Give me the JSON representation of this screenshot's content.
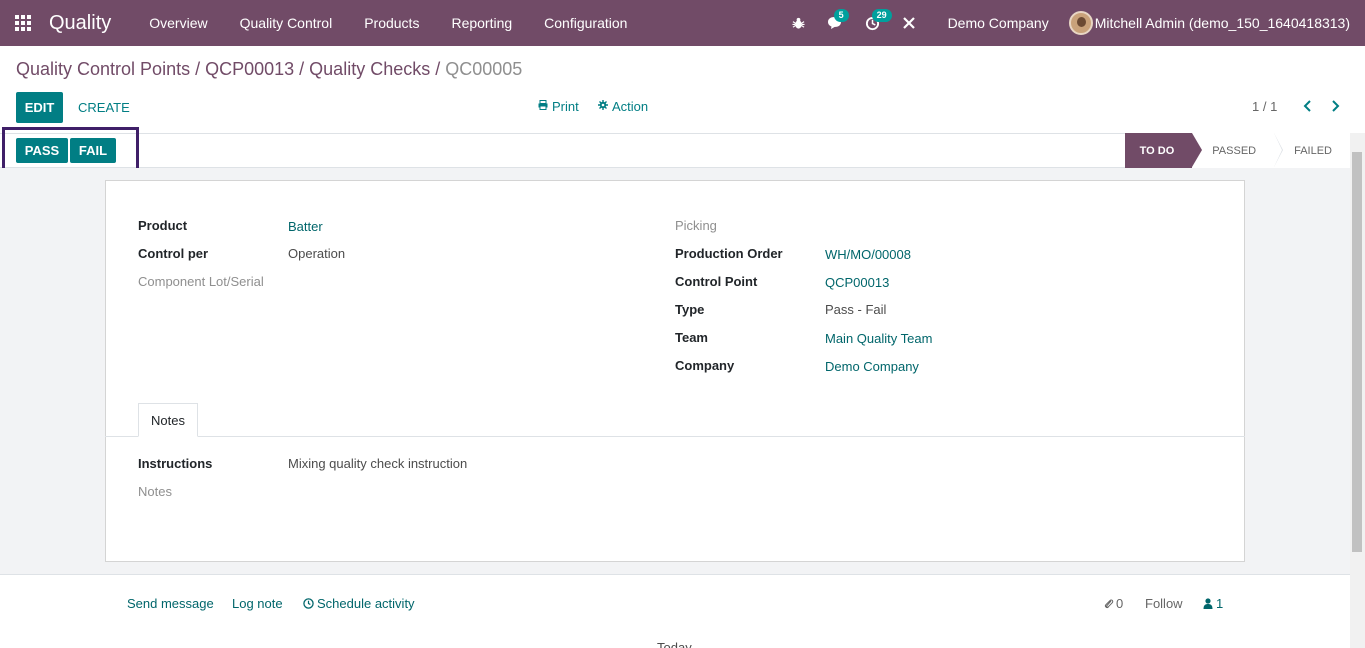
{
  "navbar": {
    "app_name": "Quality",
    "menu": [
      "Overview",
      "Quality Control",
      "Products",
      "Reporting",
      "Configuration"
    ],
    "messages_count": "5",
    "activities_count": "29",
    "company": "Demo Company",
    "user": "Mitchell Admin (demo_150_1640418313)"
  },
  "breadcrumb": {
    "items": [
      "Quality Control Points",
      "QCP00013",
      "Quality Checks"
    ],
    "separator": "/",
    "current": "QC00005"
  },
  "controls": {
    "edit": "EDIT",
    "create": "CREATE",
    "print": "Print",
    "action": "Action",
    "pager": "1 / 1"
  },
  "statusbar": {
    "pass": "PASS",
    "fail": "FAIL",
    "stages": [
      "TO DO",
      "PASSED",
      "FAILED"
    ],
    "current_stage": "TO DO"
  },
  "form": {
    "left": [
      {
        "label": "Product",
        "value": "Batter"
      },
      {
        "label": "Control per",
        "value": "Operation"
      },
      {
        "label": "Component Lot/Serial",
        "value": ""
      }
    ],
    "right": [
      {
        "label": "Picking",
        "value": ""
      },
      {
        "label": "Production Order",
        "value": "WH/MO/00008"
      },
      {
        "label": "Control Point",
        "value": "QCP00013"
      },
      {
        "label": "Type",
        "value": "Pass - Fail"
      },
      {
        "label": "Team",
        "value": "Main Quality Team"
      },
      {
        "label": "Company",
        "value": "Demo Company"
      }
    ],
    "tab": "Notes",
    "instructions_label": "Instructions",
    "instructions_value": "Mixing quality check instruction",
    "notes_label": "Notes"
  },
  "chatter": {
    "send_message": "Send message",
    "log_note": "Log note",
    "schedule_activity": "Schedule activity",
    "attachments": "0",
    "follow": "Follow",
    "followers": "1",
    "partial_heading": "Today"
  },
  "colors": {
    "brand": "#714b67",
    "primary": "#017e84",
    "highlight_box": "#3f1f68"
  }
}
